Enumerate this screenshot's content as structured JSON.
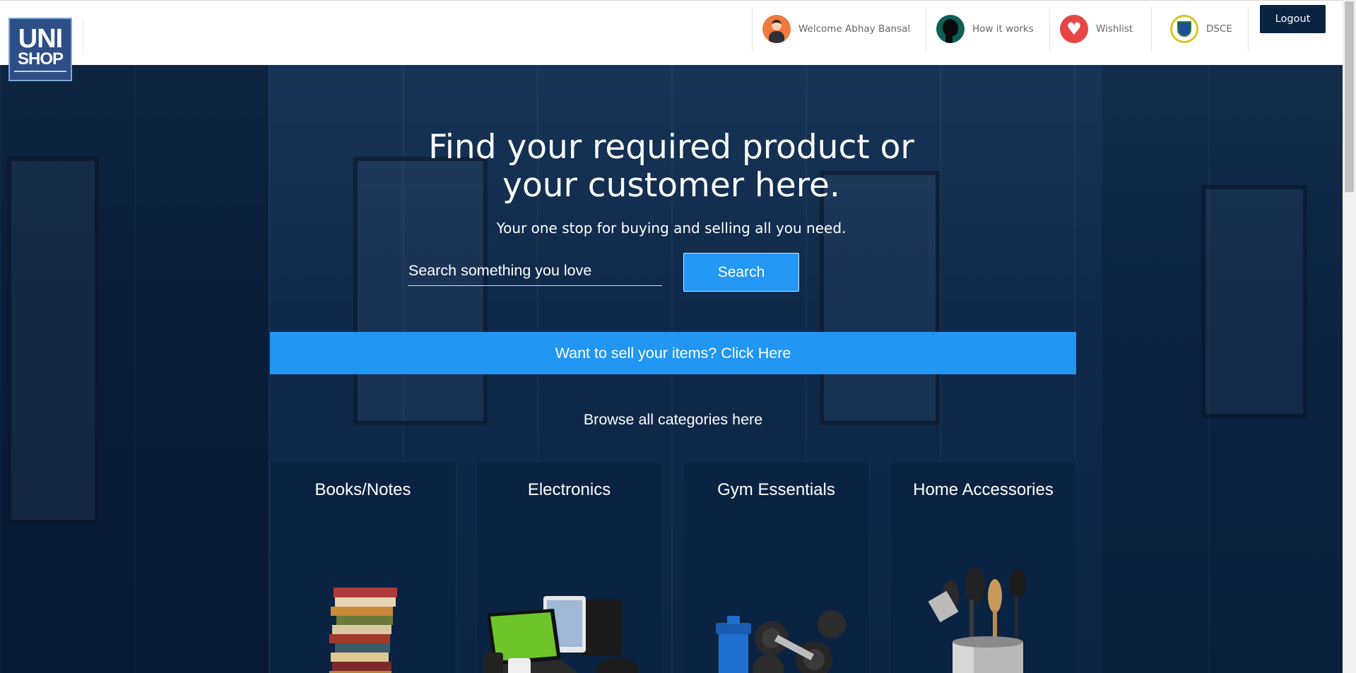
{
  "brand": {
    "logo_line1": "UNI",
    "logo_line2": "SHOP"
  },
  "nav": {
    "welcome": "Welcome Abhay Bansal",
    "how_it_works": "How it works",
    "wishlist": "Wishlist",
    "college": "DSCE",
    "logout": "Logout"
  },
  "hero": {
    "title_line1": "Find your required product or",
    "title_line2": "your customer here.",
    "subtitle": "Your one stop for buying and selling all you need.",
    "search_placeholder": "Search something you love",
    "search_value": "",
    "search_button": "Search",
    "sell_cta": "Want to sell your items? Click Here",
    "browse_heading": "Browse all categories here"
  },
  "categories": [
    {
      "label": "Books/Notes",
      "icon": "books-stack-icon"
    },
    {
      "label": "Electronics",
      "icon": "electronics-icon"
    },
    {
      "label": "Gym Essentials",
      "icon": "dumbbells-icon"
    },
    {
      "label": "Home Accessories",
      "icon": "kitchen-utensils-icon"
    }
  ],
  "colors": {
    "navy": "#0b2342",
    "accent_blue": "#2196f3",
    "wishlist_red": "#e84545",
    "user_orange": "#f07a3f"
  }
}
